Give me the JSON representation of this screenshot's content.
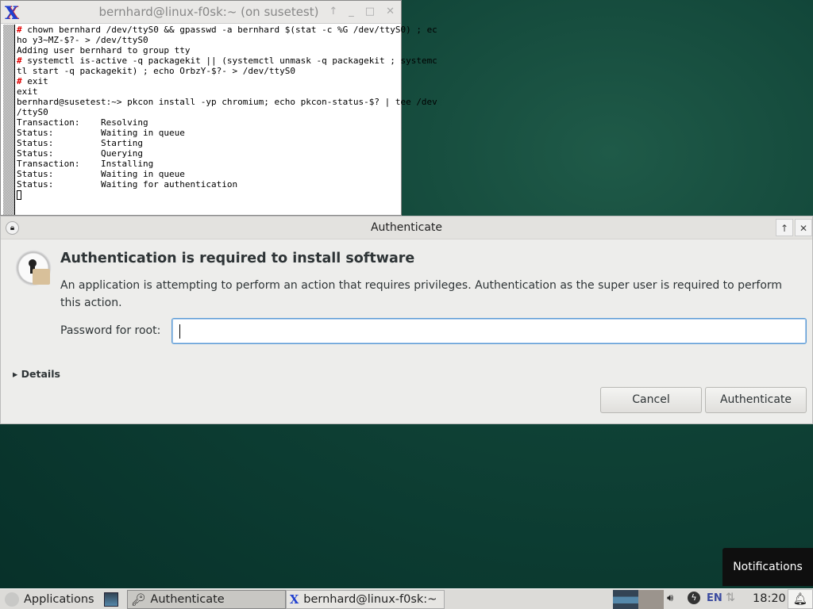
{
  "terminal": {
    "title": "bernhard@linux-f0sk:~ (on susetest)",
    "lines": [
      {
        "p": "# ",
        "t": "chown bernhard /dev/ttyS0 && gpasswd -a bernhard $(stat -c %G /dev/ttyS0) ; ec"
      },
      {
        "p": "",
        "t": "ho y3~MZ-$?- > /dev/ttyS0"
      },
      {
        "p": "",
        "t": "Adding user bernhard to group tty"
      },
      {
        "p": "# ",
        "t": "systemctl is-active -q packagekit || (systemctl unmask -q packagekit ; systemc"
      },
      {
        "p": "",
        "t": "tl start -q packagekit) ; echo OrbzY-$?- > /dev/ttyS0"
      },
      {
        "p": "# ",
        "t": "exit"
      },
      {
        "p": "",
        "t": "exit"
      },
      {
        "p": "",
        "t": "bernhard@susetest:~> pkcon install -yp chromium; echo pkcon-status-$? | tee /dev"
      },
      {
        "p": "",
        "t": "/ttyS0"
      },
      {
        "p": "",
        "t": "Transaction:    Resolving"
      },
      {
        "p": "",
        "t": "Status:         Waiting in queue"
      },
      {
        "p": "",
        "t": "Status:         Starting"
      },
      {
        "p": "",
        "t": "Status:         Querying"
      },
      {
        "p": "",
        "t": "Transaction:    Installing"
      },
      {
        "p": "",
        "t": "Status:         Waiting in queue"
      },
      {
        "p": "",
        "t": "Status:         Waiting for authentication"
      }
    ]
  },
  "dialog": {
    "title": "Authenticate",
    "heading": "Authentication is required to install software",
    "description": "An application is attempting to perform an action that requires privileges. Authentication as the super user is required to perform this action.",
    "password_label": "Password for root:",
    "password_value": "",
    "details": "Details",
    "cancel": "Cancel",
    "authenticate": "Authenticate"
  },
  "notification": "Notifications",
  "taskbar": {
    "applications": "Applications",
    "tasks": [
      "Authenticate",
      "bernhard@linux-f0sk:~"
    ],
    "keyboard": "EN",
    "clock": "18:20"
  }
}
